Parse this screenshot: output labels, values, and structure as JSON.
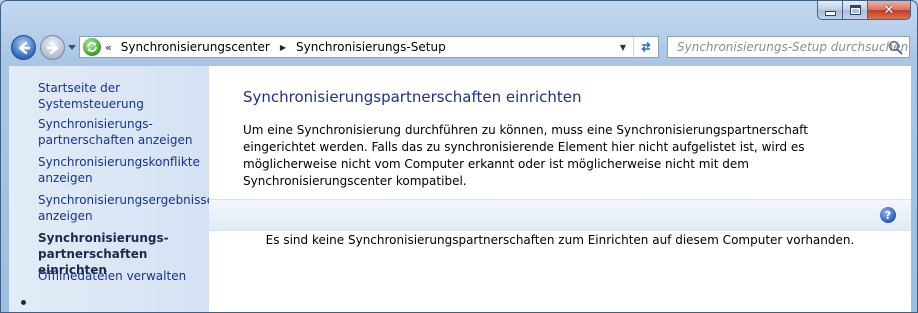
{
  "window": {
    "caption": {
      "minimize_icon": "minimize-icon",
      "maximize_icon": "maximize-icon",
      "close_symbol": "✕"
    }
  },
  "nav": {
    "back_icon": "back-arrow-icon",
    "forward_icon": "forward-arrow-icon"
  },
  "address": {
    "overflow": "«",
    "crumbs": [
      "Synchronisierungscenter",
      "Synchronisierungs-Setup"
    ],
    "separator": "▶"
  },
  "search": {
    "placeholder": "Synchronisierungs-Setup durchsuchen"
  },
  "sidebar": {
    "home": "Startseite der Systemsteuerung",
    "items": [
      {
        "label": "Synchronisierungs-\npartnerschaften anzeigen"
      },
      {
        "label": "Synchronisierungskonflikte\nanzeigen"
      },
      {
        "label": "Synchronisierungsergebnisse\nanzeigen"
      },
      {
        "label": "Synchronisierungs-\npartnerschaften einrichten",
        "active": true
      },
      {
        "label": "Offlinedateien verwalten"
      }
    ]
  },
  "main": {
    "title": "Synchronisierungspartnerschaften einrichten",
    "description": "Um eine Synchronisierung durchführen zu können, muss eine Synchronisierungspartnerschaft eingerichtet werden. Falls das zu synchronisierende Element hier nicht aufgelistet ist, wird es möglicherweise nicht vom Computer erkannt oder ist möglicherweise nicht mit dem Synchronisierungscenter kompatibel.",
    "help": "?",
    "empty_message": "Es sind keine Synchronisierungspartnerschaften zum Einrichten auf diesem Computer vorhanden."
  },
  "colors": {
    "link": "#15348d",
    "title": "#1e3287",
    "sidebar_bg": "#dce7f5",
    "frame": "#a9c6e6"
  }
}
